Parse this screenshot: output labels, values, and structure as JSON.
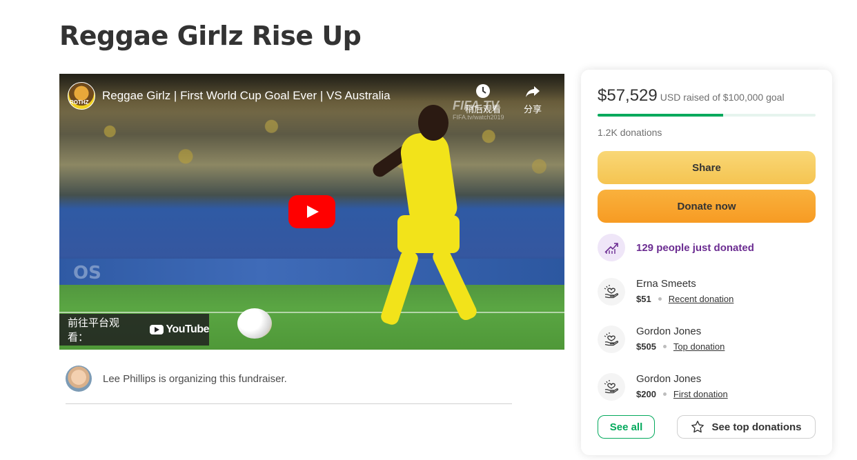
{
  "page": {
    "title": "Reggae Girlz Rise Up"
  },
  "video": {
    "title": "Reggae Girlz | First World Cup Goal Ever | VS Australia",
    "channel_badge": "ROTHZ",
    "watch_later_label": "稍后观看",
    "share_label": "分享",
    "broadcaster_mark": "FIFA.TV",
    "broadcaster_url": "FIFA.tv/watch2019",
    "board_text": "OS",
    "watch_on_label": "前往平台观看：",
    "youtube_label": "YouTube",
    "icons": {
      "watch_later": "clock-icon",
      "share": "share-arrow-icon",
      "play": "play-icon"
    }
  },
  "organizer": {
    "text": "Lee Phillips is organizing this fundraiser."
  },
  "donation_card": {
    "amount": "$57,529",
    "goal_text": "USD raised of $100,000 goal",
    "progress": 0.575,
    "donations_count": "1.2K donations",
    "share_label": "Share",
    "donate_label": "Donate now",
    "trend_text": "129 people just donated",
    "donors": [
      {
        "name": "Erna Smeets",
        "amount": "$51",
        "tag": "Recent donation"
      },
      {
        "name": "Gordon Jones",
        "amount": "$505",
        "tag": "Top donation"
      },
      {
        "name": "Gordon Jones",
        "amount": "$200",
        "tag": "First donation"
      }
    ],
    "see_all_label": "See all",
    "see_top_label": "See top donations",
    "colors": {
      "accent_green": "#02a95c",
      "share_yellow": "#f5c451",
      "donate_orange": "#f79b23",
      "trend_purple": "#6b2c91"
    }
  }
}
